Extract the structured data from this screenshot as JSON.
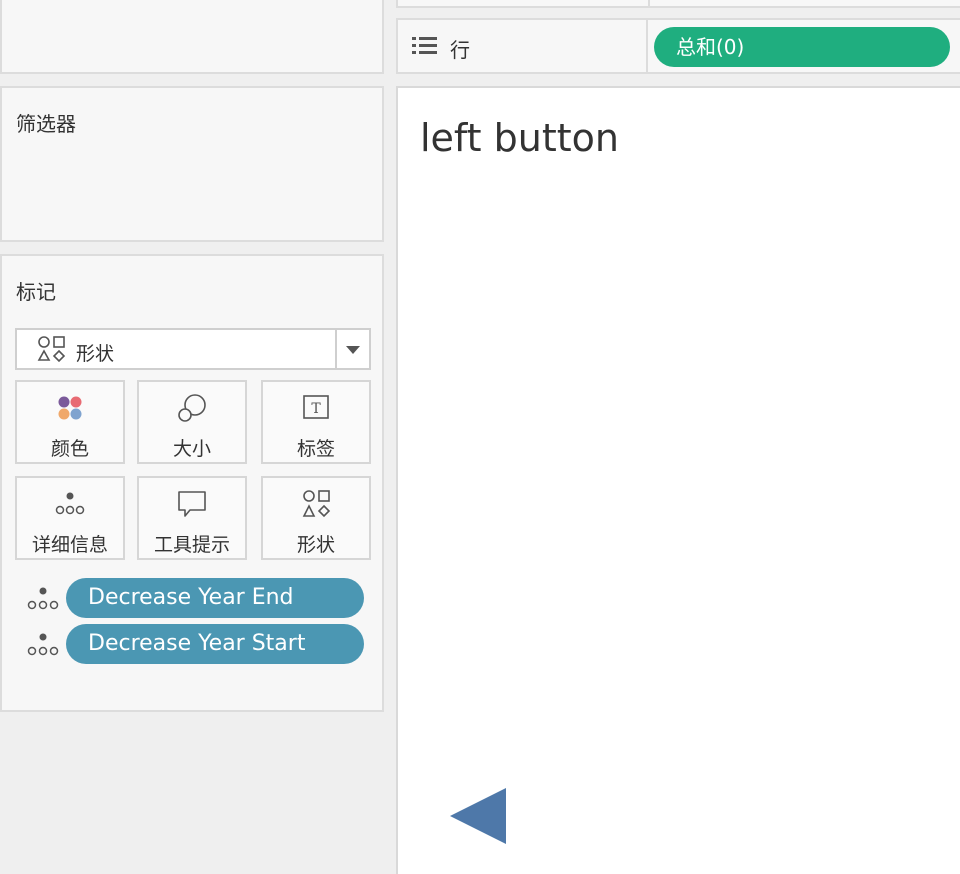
{
  "shelves": {
    "rows_label": "行",
    "rows_pill": "总和(0)"
  },
  "filters": {
    "title": "筛选器"
  },
  "marks": {
    "title": "标记",
    "mark_type": "形状",
    "cards": [
      {
        "label": "颜色",
        "icon": "color-icon"
      },
      {
        "label": "大小",
        "icon": "size-icon"
      },
      {
        "label": "标签",
        "icon": "label-icon"
      },
      {
        "label": "详细信息",
        "icon": "detail-icon"
      },
      {
        "label": "工具提示",
        "icon": "tooltip-icon"
      },
      {
        "label": "形状",
        "icon": "shape-icon"
      }
    ],
    "pills": [
      {
        "label": "Decrease Year End",
        "icon": "detail-icon"
      },
      {
        "label": "Decrease Year Start",
        "icon": "detail-icon"
      }
    ]
  },
  "view": {
    "title": "left button",
    "shape": "left-triangle"
  },
  "colors": {
    "rows_pill": "#1fae7f",
    "detail_pill": "#4b97b3",
    "triangle": "#4e78a9"
  }
}
